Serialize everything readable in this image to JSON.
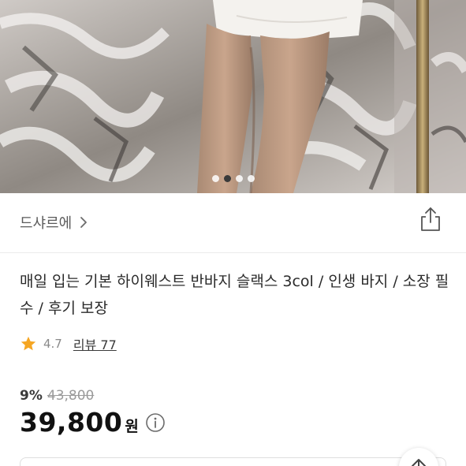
{
  "gallery": {
    "image_alt": "product photo",
    "page_count": 4,
    "active_index": 1
  },
  "shop": {
    "name": "드샤르에",
    "chevron": "chevron-right-icon",
    "share_icon": "share-icon"
  },
  "product": {
    "title": "매일 입는 기본 하이웨스트 반바지 슬랙스 3col / 인생 바지 / 소장 필수 / 후기 보장",
    "rating": "4.7",
    "review_label": "리뷰 77",
    "discount": "9%",
    "original_price": "43,800",
    "price": "39,800",
    "currency": "원",
    "info_icon": "info-icon"
  },
  "colors": {
    "star": "#F5A623",
    "active_dot": "#3a3a3a"
  }
}
